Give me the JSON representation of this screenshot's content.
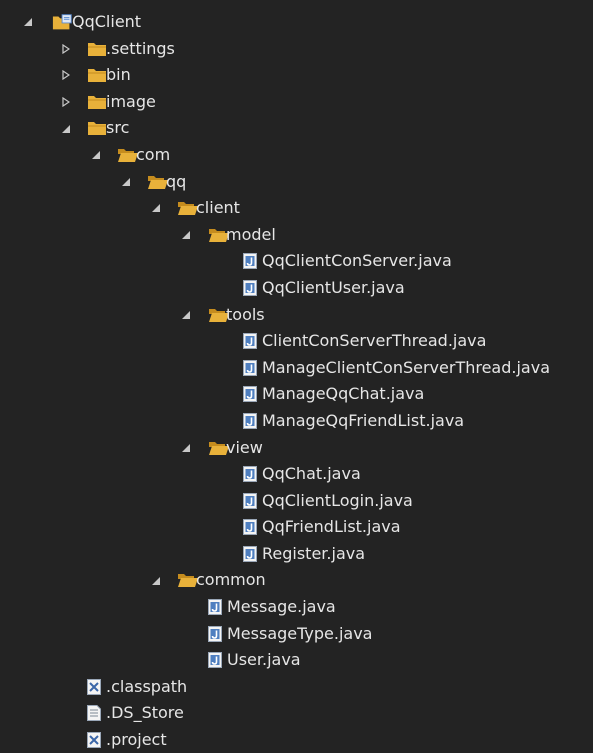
{
  "tree": [
    {
      "label": "QqClient",
      "type": "project",
      "depth": 0,
      "state": "expanded"
    },
    {
      "label": ".settings",
      "type": "folder",
      "depth": 1,
      "state": "collapsed"
    },
    {
      "label": "bin",
      "type": "folder",
      "depth": 1,
      "state": "collapsed"
    },
    {
      "label": "image",
      "type": "folder",
      "depth": 1,
      "state": "collapsed"
    },
    {
      "label": "src",
      "type": "folder",
      "depth": 1,
      "state": "expanded"
    },
    {
      "label": "com",
      "type": "folder-open",
      "depth": 2,
      "state": "expanded"
    },
    {
      "label": "qq",
      "type": "folder-open",
      "depth": 3,
      "state": "expanded"
    },
    {
      "label": "client",
      "type": "folder-open",
      "depth": 4,
      "state": "expanded"
    },
    {
      "label": "model",
      "type": "folder-open",
      "depth": 5,
      "state": "expanded"
    },
    {
      "label": "QqClientConServer.java",
      "type": "java",
      "depth": 6,
      "state": "leaf"
    },
    {
      "label": "QqClientUser.java",
      "type": "java",
      "depth": 6,
      "state": "leaf"
    },
    {
      "label": "tools",
      "type": "folder-open",
      "depth": 5,
      "state": "expanded"
    },
    {
      "label": "ClientConServerThread.java",
      "type": "java",
      "depth": 6,
      "state": "leaf"
    },
    {
      "label": "ManageClientConServerThread.java",
      "type": "java",
      "depth": 6,
      "state": "leaf"
    },
    {
      "label": "ManageQqChat.java",
      "type": "java",
      "depth": 6,
      "state": "leaf"
    },
    {
      "label": "ManageQqFriendList.java",
      "type": "java",
      "depth": 6,
      "state": "leaf"
    },
    {
      "label": "view",
      "type": "folder-open",
      "depth": 5,
      "state": "expanded"
    },
    {
      "label": "QqChat.java",
      "type": "java",
      "depth": 6,
      "state": "leaf"
    },
    {
      "label": "QqClientLogin.java",
      "type": "java",
      "depth": 6,
      "state": "leaf"
    },
    {
      "label": "QqFriendList.java",
      "type": "java",
      "depth": 6,
      "state": "leaf"
    },
    {
      "label": "Register.java",
      "type": "java",
      "depth": 6,
      "state": "leaf"
    },
    {
      "label": "common",
      "type": "folder-open",
      "depth": 4,
      "state": "expanded"
    },
    {
      "label": "Message.java",
      "type": "java",
      "depth": 5,
      "state": "leaf"
    },
    {
      "label": "MessageType.java",
      "type": "java",
      "depth": 5,
      "state": "leaf"
    },
    {
      "label": "User.java",
      "type": "java",
      "depth": 5,
      "state": "leaf"
    },
    {
      "label": ".classpath",
      "type": "xml",
      "depth": 2,
      "state": "leaf"
    },
    {
      "label": ".DS_Store",
      "type": "text",
      "depth": 2,
      "state": "leaf"
    },
    {
      "label": ".project",
      "type": "xml",
      "depth": 2,
      "state": "leaf"
    }
  ],
  "colors": {
    "background": "#232323",
    "text": "#e6e6e6",
    "folder": "#e8b13a",
    "arrow": "#c8c8c8",
    "java_icon_bg": "#4f7fc0"
  }
}
